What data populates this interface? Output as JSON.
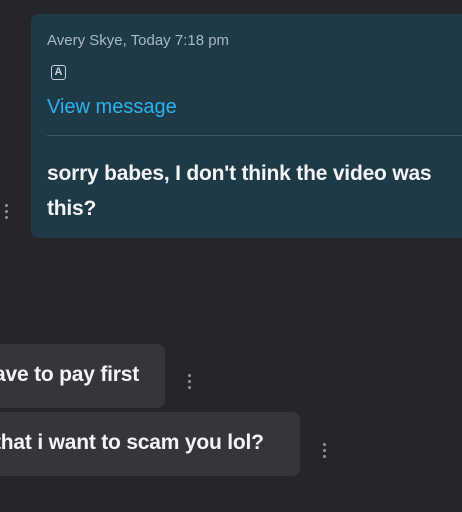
{
  "reply": {
    "sender_meta": "Avery Skye, Today 7:18 pm",
    "badge_letter": "A",
    "view_link": "View message",
    "text_line_1": "sorry babes, I don't think the video was",
    "text_line_2": "this?"
  },
  "messages": [
    {
      "text": "ave to pay first"
    },
    {
      "text": "that i want to scam you lol?"
    }
  ],
  "icons": {
    "more": "vertical-ellipsis-icon",
    "badge": "letter-a-badge-icon"
  },
  "colors": {
    "background": "#26262a",
    "reply_card": "#1e3a47",
    "link": "#2bb3f0",
    "bubble": "#35363a",
    "text": "#f2f4f5"
  }
}
